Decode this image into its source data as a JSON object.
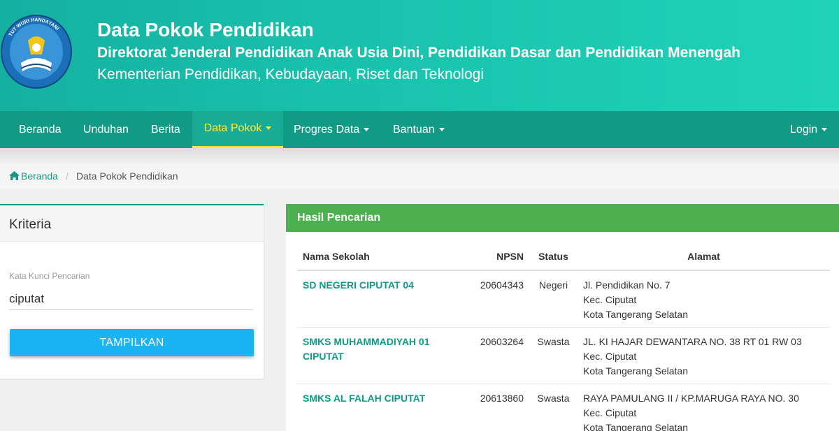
{
  "header": {
    "title": "Data Pokok Pendidikan",
    "subtitle": "Direktorat Jenderal Pendidikan Anak Usia Dini, Pendidikan Dasar dan Pendidikan Menengah",
    "ministry": "Kementerian Pendidikan, Kebudayaan, Riset dan Teknologi",
    "logo_text": "TUT WURI HANDAYANI"
  },
  "nav": {
    "items": [
      {
        "label": "Beranda"
      },
      {
        "label": "Unduhan"
      },
      {
        "label": "Berita"
      },
      {
        "label": "Data Pokok"
      },
      {
        "label": "Progres Data"
      },
      {
        "label": "Bantuan"
      }
    ],
    "login": "Login",
    "active": "Data Pokok"
  },
  "breadcrumb": {
    "home": "Beranda",
    "separator": "/",
    "current": "Data Pokok Pendidikan"
  },
  "kriteria": {
    "title": "Kriteria",
    "field_label": "Kata Kunci Pencarian",
    "field_value": "ciputat",
    "button": "TAMPILKAN"
  },
  "hasil": {
    "title": "Hasil Pencarian",
    "columns": [
      "Nama Sekolah",
      "NPSN",
      "Status",
      "Alamat"
    ],
    "rows": [
      {
        "nama": "SD NEGERI CIPUTAT 04",
        "npsn": "20604343",
        "status": "Negeri",
        "alamat1": "Jl. Pendidikan No. 7",
        "alamat2": "Kec. Ciputat",
        "alamat3": "Kota Tangerang Selatan"
      },
      {
        "nama": "SMKS MUHAMMADIYAH 01 CIPUTAT",
        "npsn": "20603264",
        "status": "Swasta",
        "alamat1": "JL. KI HAJAR DEWANTARA NO. 38 RT 01 RW 03",
        "alamat2": "Kec. Ciputat",
        "alamat3": "Kota Tangerang Selatan"
      },
      {
        "nama": "SMKS AL FALAH CIPUTAT",
        "npsn": "20613860",
        "status": "Swasta",
        "alamat1": "RAYA PAMULANG II / KP.MARUGA RAYA NO. 30",
        "alamat2": "Kec. Ciputat",
        "alamat3": "Kota Tangerang Selatan"
      }
    ]
  },
  "colors": {
    "header_start": "#15b0a0",
    "header_end": "#1fd3b8",
    "navbar": "#119a85",
    "active_nav_text": "#ffeb3b",
    "results_header": "#4caf50",
    "button": "#1ab4f5",
    "link": "#119a85"
  },
  "icons": {
    "breadcrumb_home": "home-icon",
    "dropdown": "caret-down-icon"
  }
}
